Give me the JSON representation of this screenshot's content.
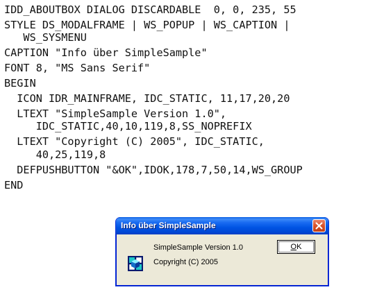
{
  "code": {
    "lines": [
      "IDD_ABOUTBOX DIALOG DISCARDABLE  0, 0, 235, 55",
      "STYLE DS_MODALFRAME | WS_POPUP | WS_CAPTION |",
      "   WS_SYSMENU",
      "CAPTION \"Info über SimpleSample\"",
      "FONT 8, \"MS Sans Serif\"",
      "BEGIN",
      "  ICON IDR_MAINFRAME, IDC_STATIC, 11,17,20,20",
      "  LTEXT \"SimpleSample Version 1.0\",",
      "     IDC_STATIC,40,10,119,8,SS_NOPREFIX",
      "  LTEXT \"Copyright (C) 2005\", IDC_STATIC,",
      "     40,25,119,8",
      "  DEFPUSHBUTTON \"&OK\",IDOK,178,7,50,14,WS_GROUP",
      "END"
    ]
  },
  "dialog": {
    "title": "Info über SimpleSample",
    "version_text": "SimpleSample Version 1.0",
    "copyright_text": "Copyright (C) 2005",
    "ok_button": {
      "mnemonic": "O",
      "rest": "K"
    },
    "icons": {
      "close": "close-icon",
      "app": "app-icon"
    },
    "colors": {
      "titlebar": "#0054e3",
      "close_button": "#d9532a",
      "client": "#ece9d8"
    }
  }
}
